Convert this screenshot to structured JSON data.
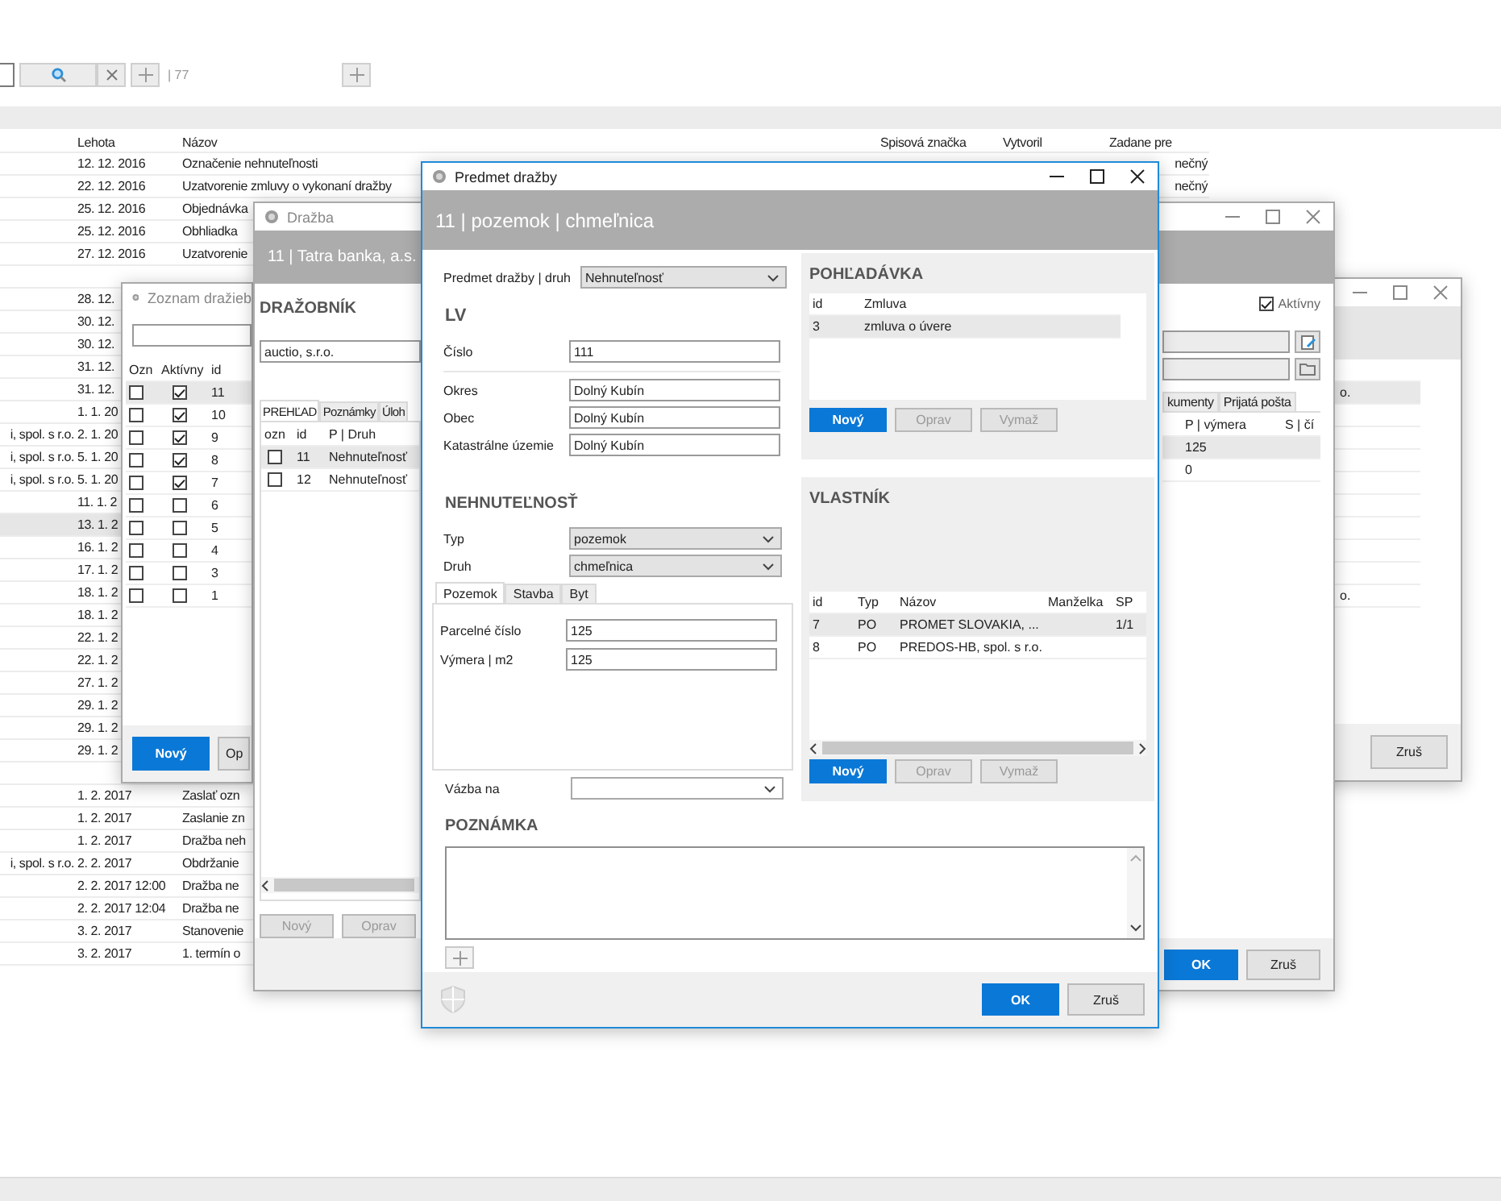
{
  "app": {
    "toolbar": {
      "count": "| 77"
    },
    "table": {
      "columns": [
        "Lehota",
        "Názov",
        "Spisová značka",
        "Vytvoril",
        "Zadane pre"
      ],
      "rows": [
        {
          "lehota": "12. 12. 2016",
          "nazov": "Označenie nehnuteľnosti",
          "zadane_pre": "nečný",
          "selected": false
        },
        {
          "lehota": "22. 12. 2016",
          "nazov": "Uzatvorenie zmluvy o vykonaní dražby",
          "zadane_pre": "nečný",
          "selected": false
        },
        {
          "lehota": "25. 12. 2016",
          "nazov": "Objednávka",
          "selected": false
        },
        {
          "lehota": "25. 12. 2016",
          "nazov": "Obhliadka",
          "selected": false
        },
        {
          "lehota": "27. 12. 2016",
          "nazov": "Uzatvorenie",
          "selected": false
        },
        {
          "selected": false
        },
        {
          "lehota": "28. 12.",
          "selected": false
        },
        {
          "lehota": "30. 12.",
          "selected": false
        },
        {
          "lehota": "30. 12.",
          "selected": false
        },
        {
          "lehota": "31. 12.",
          "selected": false
        },
        {
          "lehota": "31. 12.",
          "selected": false
        },
        {
          "lehota": "1. 1. 20",
          "selected": false
        },
        {
          "column_1": "i, spol. s r.o.",
          "lehota": "2. 1. 20",
          "selected": false
        },
        {
          "column_1": "i, spol. s r.o.",
          "lehota": "5. 1. 20",
          "selected": false
        },
        {
          "column_1": "i, spol. s r.o.",
          "lehota": "5. 1. 20",
          "selected": false
        },
        {
          "lehota": "11. 1. 2",
          "selected": false
        },
        {
          "lehota": "13. 1. 2",
          "selected": true
        },
        {
          "lehota": "16. 1. 2",
          "selected": false
        },
        {
          "lehota": "17. 1. 2",
          "selected": false
        },
        {
          "lehota": "18. 1. 2",
          "selected": false
        },
        {
          "lehota": "18. 1. 2",
          "selected": false
        },
        {
          "lehota": "22. 1. 2",
          "selected": false
        },
        {
          "lehota": "22. 1. 2",
          "selected": false
        },
        {
          "lehota": "27. 1. 2",
          "selected": false
        },
        {
          "lehota": "29. 1. 2",
          "selected": false
        },
        {
          "lehota": "29. 1. 2",
          "selected": false
        },
        {
          "lehota": "29. 1. 2",
          "selected": false
        },
        {
          "selected": false
        },
        {
          "lehota": "1. 2. 2017",
          "nazov": "Zaslať ozn",
          "selected": false
        },
        {
          "lehota": "1. 2. 2017",
          "nazov": "Zaslanie zn",
          "selected": false
        },
        {
          "lehota": "1. 2. 2017",
          "nazov": "Dražba neh",
          "selected": false
        },
        {
          "column_1": "i, spol. s r.o.",
          "lehota": "2. 2. 2017",
          "nazov": "Obdržanie",
          "selected": false
        },
        {
          "lehota": "2. 2. 2017 12:00",
          "nazov": "Dražba ne",
          "selected": false
        },
        {
          "lehota": "2. 2. 2017 12:04",
          "nazov": "Dražba ne",
          "selected": false
        },
        {
          "lehota": "3. 2. 2017",
          "nazov": "Stanovenie",
          "selected": false
        },
        {
          "lehota": "3. 2. 2017",
          "nazov": "1. termín o",
          "selected": false
        }
      ]
    }
  },
  "zoznam": {
    "title": "Zoznam dražieb",
    "columns": [
      "Ozn",
      "Aktívny",
      "id"
    ],
    "rows": [
      {
        "ozn": false,
        "aktivny": true,
        "id": "11",
        "selected": true
      },
      {
        "ozn": false,
        "aktivny": true,
        "id": "10",
        "selected": false
      },
      {
        "ozn": false,
        "aktivny": true,
        "id": "9",
        "selected": false
      },
      {
        "ozn": false,
        "aktivny": true,
        "id": "8",
        "selected": false
      },
      {
        "ozn": false,
        "aktivny": true,
        "id": "7",
        "selected": false
      },
      {
        "ozn": false,
        "aktivny": false,
        "id": "6",
        "selected": false
      },
      {
        "ozn": false,
        "aktivny": false,
        "id": "5",
        "selected": false
      },
      {
        "ozn": false,
        "aktivny": false,
        "id": "4",
        "selected": false
      },
      {
        "ozn": false,
        "aktivny": false,
        "id": "3",
        "selected": false
      },
      {
        "ozn": false,
        "aktivny": false,
        "id": "1",
        "selected": false
      }
    ],
    "buttons": [
      {
        "label": "Nový",
        "primary": true
      },
      {
        "label": "Op",
        "primary": false
      }
    ]
  },
  "third_window": {
    "rows": [
      {
        "selected": false
      },
      {
        "text": "o.",
        "selected": true
      },
      {
        "selected": false
      },
      {
        "selected": false
      },
      {
        "selected": false
      },
      {
        "selected": false
      },
      {
        "selected": false
      },
      {
        "selected": false
      },
      {
        "selected": false
      },
      {
        "selected": false
      },
      {
        "text": "o.",
        "selected": false
      }
    ],
    "buttons": [
      {
        "label": "Zruš",
        "primary": false
      }
    ]
  },
  "drazba": {
    "title": "Dražba",
    "header": "11 | Tatra banka, a.s.",
    "section": "DRAŽOBNÍK",
    "auctioneer": "auctio, s.r.o.",
    "active": {
      "label": "Aktívny",
      "checked": true
    },
    "tabs": [
      {
        "label": "PREHĽAD",
        "selected": true
      },
      {
        "label": "Poznámky",
        "selected": false
      },
      {
        "label": "Úloh",
        "selected": false
      }
    ],
    "right_tabs": [
      {
        "label": "kumenty",
        "selected": false
      },
      {
        "label": "Prijatá pošta",
        "selected": false
      }
    ],
    "columns": [
      "ozn",
      "id",
      "P | Druh"
    ],
    "right_columns": [
      "P | výmera",
      "S | čí"
    ],
    "rows": [
      {
        "ozn": false,
        "id": "11",
        "druh": "Nehnuteľnosť",
        "vymera": "125",
        "selected": true
      },
      {
        "ozn": false,
        "id": "12",
        "druh": "Nehnuteľnosť",
        "vymera": "0",
        "selected": false
      }
    ],
    "buttons": [
      {
        "label": "Nový",
        "disabled": true
      },
      {
        "label": "Oprav",
        "disabled": true
      }
    ],
    "footer_buttons": [
      {
        "label": "OK",
        "primary": true
      },
      {
        "label": "Zruš",
        "primary": false
      }
    ]
  },
  "predmet": {
    "title": "Predmet dražby",
    "header": "11 | pozemok | chmeľnica",
    "druh": {
      "label": "Predmet dražby | druh",
      "value": "Nehnuteľnosť"
    },
    "lv": {
      "heading": "LV",
      "fields": [
        {
          "label": "Číslo",
          "value": "111"
        },
        {
          "label": "Okres",
          "value": "Dolný Kubín"
        },
        {
          "label": "Obec",
          "value": "Dolný Kubín"
        },
        {
          "label": "Katastrálne územie",
          "value": "Dolný Kubín"
        }
      ]
    },
    "nehnutelnost": {
      "heading": "NEHNUTEĽNOSŤ",
      "selects": [
        {
          "label": "Typ",
          "value": "pozemok"
        },
        {
          "label": "Druh",
          "value": "chmeľnica"
        }
      ],
      "tabs": [
        {
          "label": "Pozemok",
          "selected": true
        },
        {
          "label": "Stavba",
          "selected": false
        },
        {
          "label": "Byt",
          "selected": false
        }
      ],
      "fields": [
        {
          "label": "Parcelné číslo",
          "value": "125"
        },
        {
          "label": "Výmera | m2",
          "value": "125"
        }
      ]
    },
    "vazba": {
      "label": "Vázba na"
    },
    "pohladavka": {
      "heading": "POHĽADÁVKA",
      "columns": [
        "id",
        "Zmluva"
      ],
      "rows": [
        {
          "id": "3",
          "zmluva": "zmluva o úvere",
          "selected": true
        }
      ],
      "buttons": [
        {
          "label": "Nový",
          "primary": true,
          "disabled": false
        },
        {
          "label": "Oprav",
          "primary": false,
          "disabled": true
        },
        {
          "label": "Vymaž",
          "primary": false,
          "disabled": true
        }
      ]
    },
    "vlastnik": {
      "heading": "VLASTNÍK",
      "columns": [
        "id",
        "Typ",
        "Názov",
        "Manželka",
        "SP"
      ],
      "rows": [
        {
          "id": "7",
          "typ": "PO",
          "nazov": "PROMET SLOVAKIA, ...",
          "sp": "1/1",
          "selected": true
        },
        {
          "id": "8",
          "typ": "PO",
          "nazov": "PREDOS-HB, spol. s r.o.",
          "selected": false
        }
      ],
      "buttons": [
        {
          "label": "Nový",
          "primary": true,
          "disabled": false
        },
        {
          "label": "Oprav",
          "primary": false,
          "disabled": true
        },
        {
          "label": "Vymaž",
          "primary": false,
          "disabled": true
        }
      ]
    },
    "note": {
      "heading": "POZNÁMKA"
    },
    "buttons": [
      {
        "label": "OK",
        "primary": true
      },
      {
        "label": "Zruš",
        "primary": false
      }
    ]
  }
}
